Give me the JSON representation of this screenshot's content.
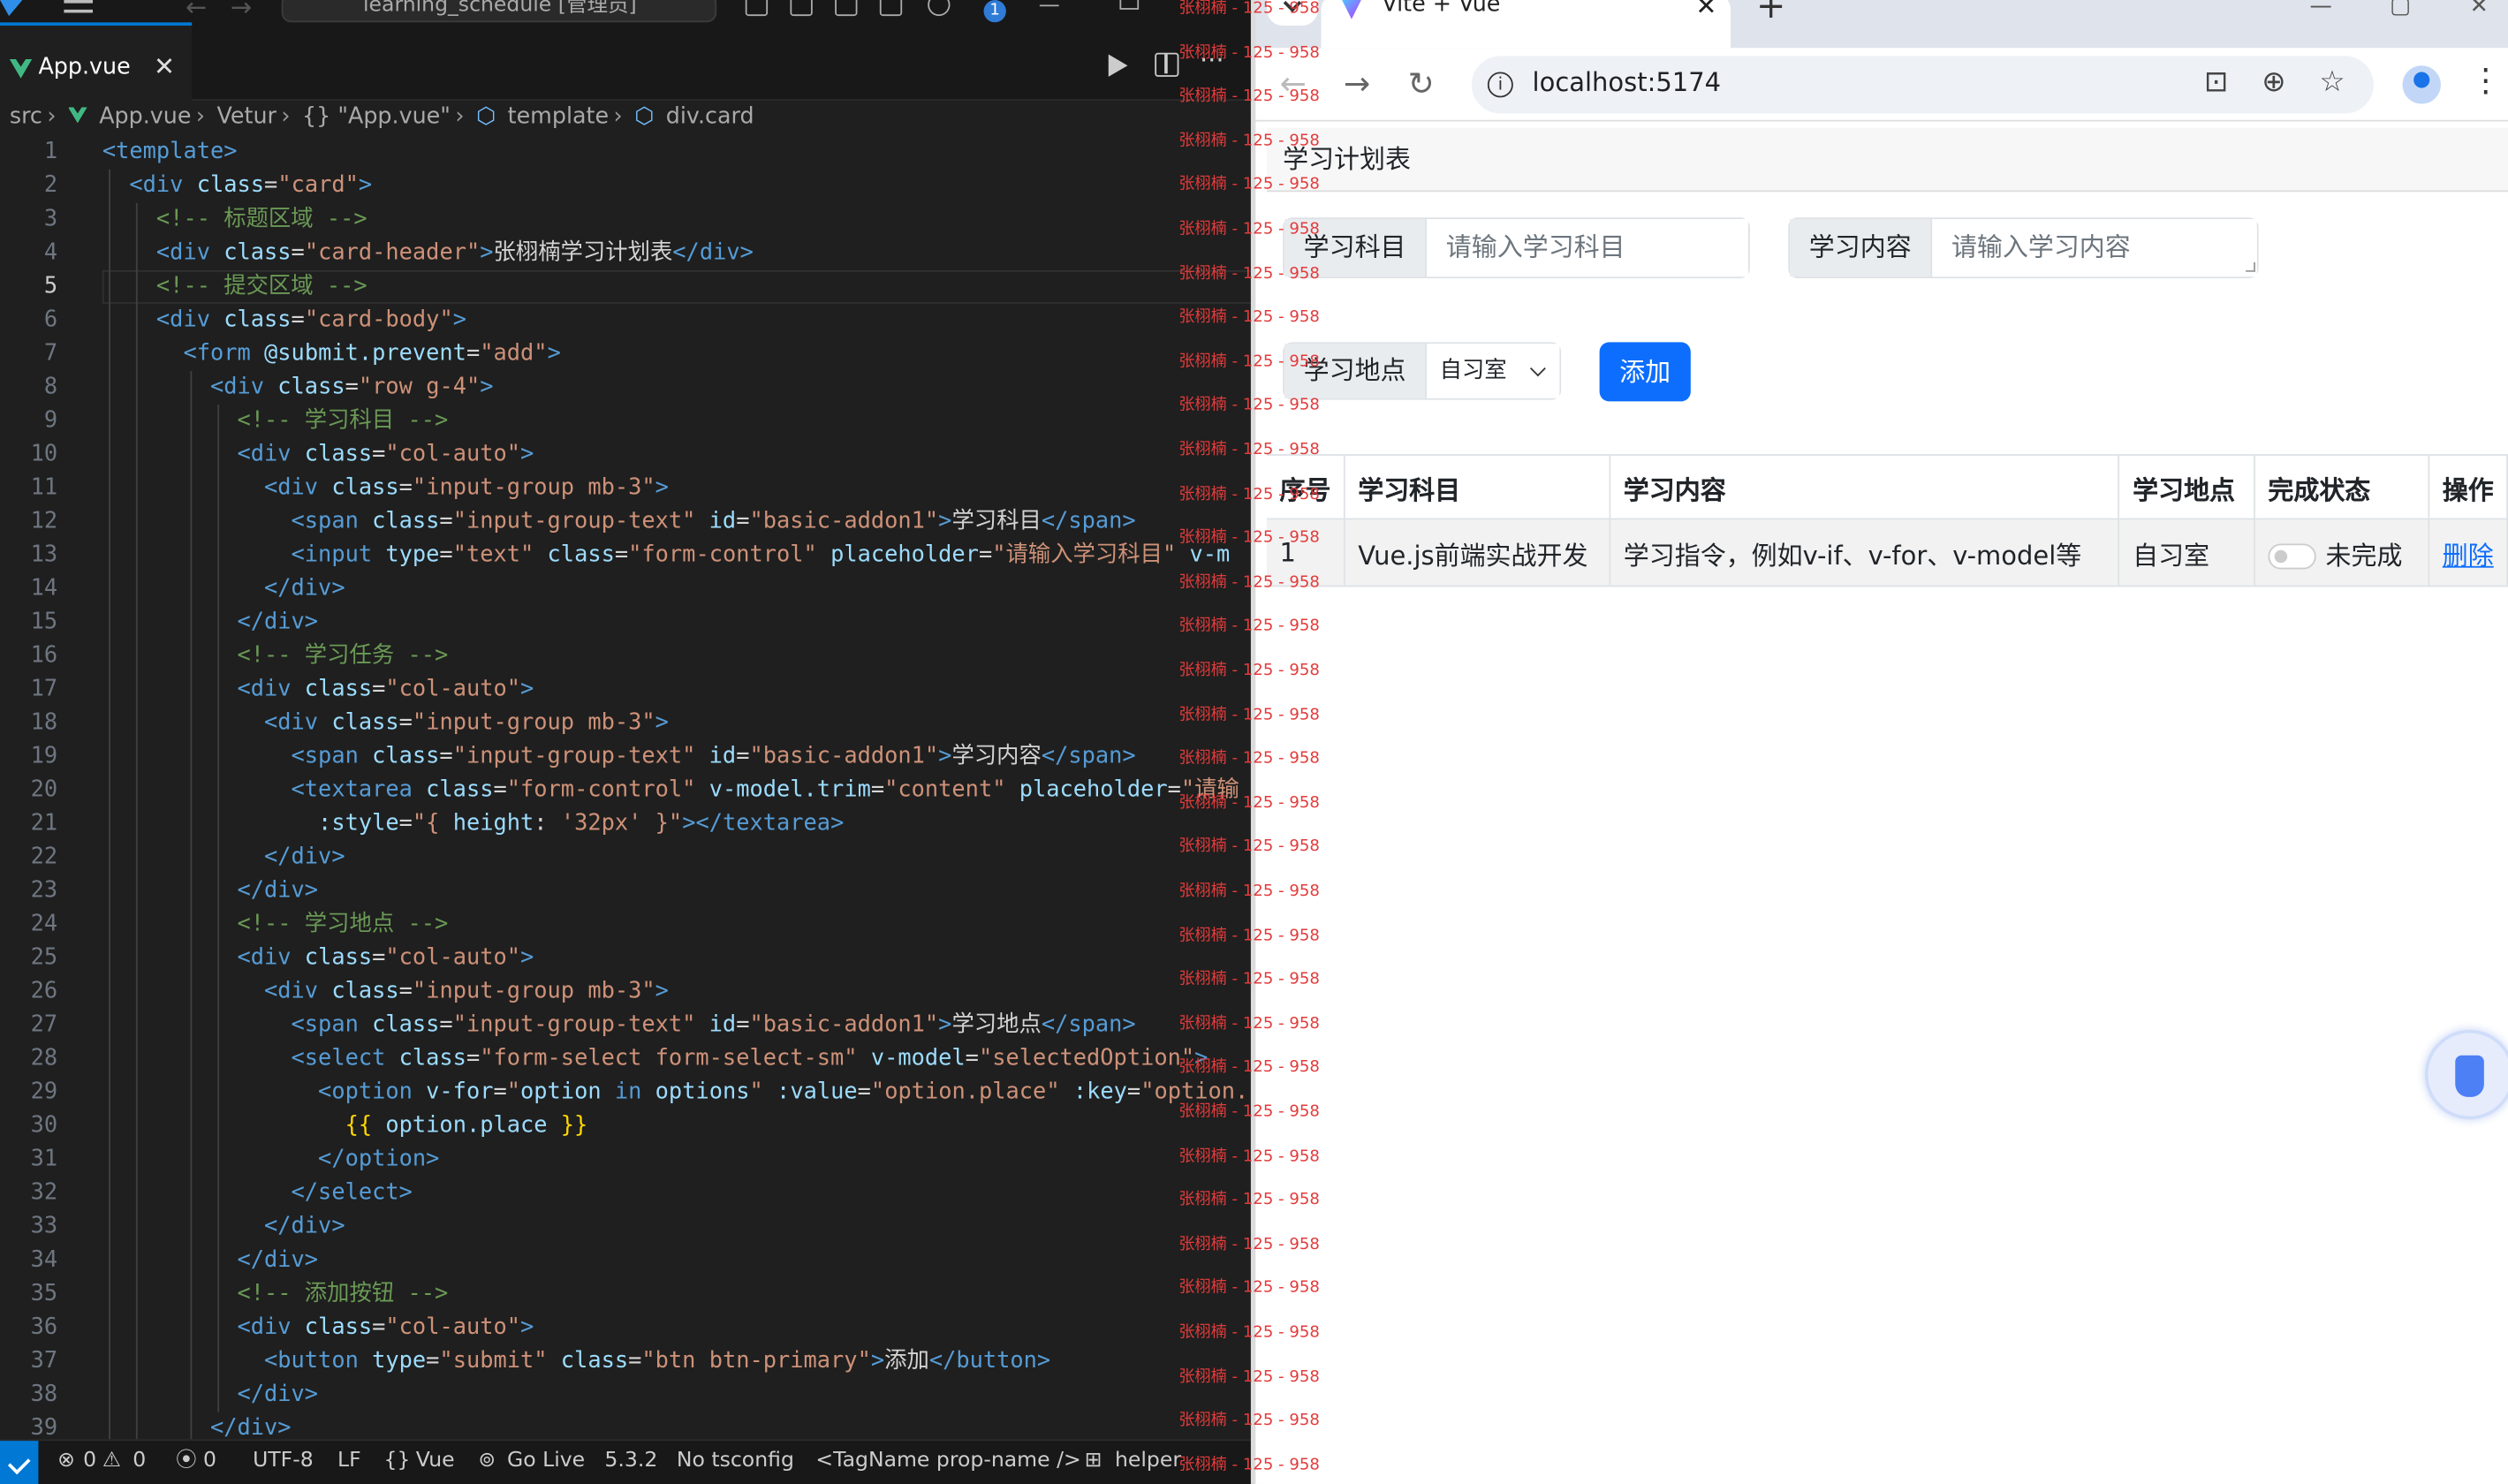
{
  "vscode": {
    "command_center": "learning_schedule [管理员]",
    "notifications": "1",
    "tab_label": "App.vue",
    "breadcrumb": [
      "src",
      "App.vue",
      "Vetur",
      "{} \"App.vue\"",
      "template",
      "div.card"
    ],
    "line_numbers": [
      "1",
      "2",
      "3",
      "4",
      "5",
      "6",
      "7",
      "8",
      "9",
      "10",
      "11",
      "12",
      "13",
      "14",
      "15",
      "16",
      "17",
      "18",
      "19",
      "20",
      "21",
      "22",
      "23",
      "24",
      "25",
      "26",
      "27",
      "28",
      "29",
      "30",
      "31",
      "32",
      "33",
      "34",
      "35",
      "36",
      "37",
      "38",
      "39"
    ],
    "current_line": "5",
    "status": {
      "errors": "0",
      "warnings": "0",
      "ports": "0",
      "encoding": "UTF-8",
      "eol": "LF",
      "language": "Vue",
      "go_live": "Go Live",
      "version": "5.3.2",
      "tsconfig": "No tsconfig",
      "tagname": "<TagName prop-name />",
      "helper": "helper"
    }
  },
  "code_lines": [
    [
      [
        "t",
        "<template>"
      ]
    ],
    [
      [
        "t",
        "  <div "
      ],
      [
        "a",
        "class"
      ],
      [
        "w",
        "="
      ],
      [
        "s",
        "\"card\""
      ],
      [
        "t",
        ">"
      ]
    ],
    [
      [
        "c",
        "    <!-- 标题区域 -->"
      ]
    ],
    [
      [
        "t",
        "    <div "
      ],
      [
        "a",
        "class"
      ],
      [
        "w",
        "="
      ],
      [
        "s",
        "\"card-header\""
      ],
      [
        "t",
        ">"
      ],
      [
        "w",
        "张栩楠学习计划表"
      ],
      [
        "t",
        "</div>"
      ]
    ],
    [
      [
        "c",
        "    <!-- 提交区域 -->"
      ]
    ],
    [
      [
        "t",
        "    <div "
      ],
      [
        "a",
        "class"
      ],
      [
        "w",
        "="
      ],
      [
        "s",
        "\"card-body\""
      ],
      [
        "t",
        ">"
      ]
    ],
    [
      [
        "t",
        "      <form "
      ],
      [
        "a",
        "@submit.prevent"
      ],
      [
        "w",
        "="
      ],
      [
        "s",
        "\"add\""
      ],
      [
        "t",
        ">"
      ]
    ],
    [
      [
        "t",
        "        <div "
      ],
      [
        "a",
        "class"
      ],
      [
        "w",
        "="
      ],
      [
        "s",
        "\"row g-4\""
      ],
      [
        "t",
        ">"
      ]
    ],
    [
      [
        "c",
        "          <!-- 学习科目 -->"
      ]
    ],
    [
      [
        "t",
        "          <div "
      ],
      [
        "a",
        "class"
      ],
      [
        "w",
        "="
      ],
      [
        "s",
        "\"col-auto\""
      ],
      [
        "t",
        ">"
      ]
    ],
    [
      [
        "t",
        "            <div "
      ],
      [
        "a",
        "class"
      ],
      [
        "w",
        "="
      ],
      [
        "s",
        "\"input-group mb-3\""
      ],
      [
        "t",
        ">"
      ]
    ],
    [
      [
        "t",
        "              <span "
      ],
      [
        "a",
        "class"
      ],
      [
        "w",
        "="
      ],
      [
        "s",
        "\"input-group-text\""
      ],
      [
        "a",
        " id"
      ],
      [
        "w",
        "="
      ],
      [
        "s",
        "\"basic-addon1\""
      ],
      [
        "t",
        ">"
      ],
      [
        "w",
        "学习科目"
      ],
      [
        "t",
        "</span>"
      ]
    ],
    [
      [
        "t",
        "              <input "
      ],
      [
        "a",
        "type"
      ],
      [
        "w",
        "="
      ],
      [
        "s",
        "\"text\""
      ],
      [
        "a",
        " class"
      ],
      [
        "w",
        "="
      ],
      [
        "s",
        "\"form-control\""
      ],
      [
        "a",
        " placeholder"
      ],
      [
        "w",
        "="
      ],
      [
        "s",
        "\"请输入学习科目\""
      ],
      [
        "a",
        " v-m"
      ]
    ],
    [
      [
        "t",
        "            </div>"
      ]
    ],
    [
      [
        "t",
        "          </div>"
      ]
    ],
    [
      [
        "c",
        "          <!-- 学习任务 -->"
      ]
    ],
    [
      [
        "t",
        "          <div "
      ],
      [
        "a",
        "class"
      ],
      [
        "w",
        "="
      ],
      [
        "s",
        "\"col-auto\""
      ],
      [
        "t",
        ">"
      ]
    ],
    [
      [
        "t",
        "            <div "
      ],
      [
        "a",
        "class"
      ],
      [
        "w",
        "="
      ],
      [
        "s",
        "\"input-group mb-3\""
      ],
      [
        "t",
        ">"
      ]
    ],
    [
      [
        "t",
        "              <span "
      ],
      [
        "a",
        "class"
      ],
      [
        "w",
        "="
      ],
      [
        "s",
        "\"input-group-text\""
      ],
      [
        "a",
        " id"
      ],
      [
        "w",
        "="
      ],
      [
        "s",
        "\"basic-addon1\""
      ],
      [
        "t",
        ">"
      ],
      [
        "w",
        "学习内容"
      ],
      [
        "t",
        "</span>"
      ]
    ],
    [
      [
        "t",
        "              <textarea "
      ],
      [
        "a",
        "class"
      ],
      [
        "w",
        "="
      ],
      [
        "s",
        "\"form-control\""
      ],
      [
        "a",
        " v-model.trim"
      ],
      [
        "w",
        "="
      ],
      [
        "s",
        "\"content\""
      ],
      [
        "a",
        " placeholder"
      ],
      [
        "w",
        "="
      ],
      [
        "s",
        "\"请输"
      ]
    ],
    [
      [
        "a",
        "                :style"
      ],
      [
        "w",
        "="
      ],
      [
        "s",
        "\"{ "
      ],
      [
        "a",
        "height"
      ],
      [
        "w",
        ": "
      ],
      [
        "s",
        "'32px'"
      ],
      [
        "s",
        " }\""
      ],
      [
        "t",
        "></textarea>"
      ]
    ],
    [
      [
        "t",
        "            </div>"
      ]
    ],
    [
      [
        "t",
        "          </div>"
      ]
    ],
    [
      [
        "c",
        "          <!-- 学习地点 -->"
      ]
    ],
    [
      [
        "t",
        "          <div "
      ],
      [
        "a",
        "class"
      ],
      [
        "w",
        "="
      ],
      [
        "s",
        "\"col-auto\""
      ],
      [
        "t",
        ">"
      ]
    ],
    [
      [
        "t",
        "            <div "
      ],
      [
        "a",
        "class"
      ],
      [
        "w",
        "="
      ],
      [
        "s",
        "\"input-group mb-3\""
      ],
      [
        "t",
        ">"
      ]
    ],
    [
      [
        "t",
        "              <span "
      ],
      [
        "a",
        "class"
      ],
      [
        "w",
        "="
      ],
      [
        "s",
        "\"input-group-text\""
      ],
      [
        "a",
        " id"
      ],
      [
        "w",
        "="
      ],
      [
        "s",
        "\"basic-addon1\""
      ],
      [
        "t",
        ">"
      ],
      [
        "w",
        "学习地点"
      ],
      [
        "t",
        "</span>"
      ]
    ],
    [
      [
        "t",
        "              <select "
      ],
      [
        "a",
        "class"
      ],
      [
        "w",
        "="
      ],
      [
        "s",
        "\"form-select form-select-sm\""
      ],
      [
        "a",
        " v-model"
      ],
      [
        "w",
        "="
      ],
      [
        "s",
        "\"selectedOption\""
      ],
      [
        "t",
        ">"
      ]
    ],
    [
      [
        "t",
        "                <option "
      ],
      [
        "a",
        "v-for"
      ],
      [
        "w",
        "="
      ],
      [
        "s",
        "\""
      ],
      [
        "a",
        "option"
      ],
      [
        "t",
        " in "
      ],
      [
        "a",
        "options"
      ],
      [
        "s",
        "\""
      ],
      [
        "a",
        " :value"
      ],
      [
        "w",
        "="
      ],
      [
        "s",
        "\"option.place\""
      ],
      [
        "a",
        " :key"
      ],
      [
        "w",
        "="
      ],
      [
        "s",
        "\"option."
      ]
    ],
    [
      [
        "b",
        "                  {{ "
      ],
      [
        "a",
        "option.place"
      ],
      [
        "b",
        " }}"
      ]
    ],
    [
      [
        "t",
        "                </option>"
      ]
    ],
    [
      [
        "t",
        "              </select>"
      ]
    ],
    [
      [
        "t",
        "            </div>"
      ]
    ],
    [
      [
        "t",
        "          </div>"
      ]
    ],
    [
      [
        "c",
        "          <!-- 添加按钮 -->"
      ]
    ],
    [
      [
        "t",
        "          <div "
      ],
      [
        "a",
        "class"
      ],
      [
        "w",
        "="
      ],
      [
        "s",
        "\"col-auto\""
      ],
      [
        "t",
        ">"
      ]
    ],
    [
      [
        "t",
        "            <button "
      ],
      [
        "a",
        "type"
      ],
      [
        "w",
        "="
      ],
      [
        "s",
        "\"submit\""
      ],
      [
        "a",
        " class"
      ],
      [
        "w",
        "="
      ],
      [
        "s",
        "\"btn btn-primary\""
      ],
      [
        "t",
        ">"
      ],
      [
        "w",
        "添加"
      ],
      [
        "t",
        "</button>"
      ]
    ],
    [
      [
        "t",
        "          </div>"
      ]
    ],
    [
      [
        "t",
        "        </div>"
      ]
    ]
  ],
  "browser": {
    "tab_title": "Vite + Vue",
    "url": "localhost:5174"
  },
  "app": {
    "header": "学习计划表",
    "subject_label": "学习科目",
    "subject_placeholder": "请输入学习科目",
    "content_label": "学习内容",
    "content_placeholder": "请输入学习内容",
    "place_label": "学习地点",
    "place_selected": "自习室",
    "add_button": "添加",
    "table": {
      "headers": [
        "序号",
        "学习科目",
        "学习内容",
        "学习地点",
        "完成状态",
        "操作"
      ],
      "rows": [
        {
          "index": "1",
          "subject": "Vue.js前端实战开发",
          "content": "学习指令，例如v-if、v-for、v-model等",
          "place": "自习室",
          "status": "未完成",
          "action": "删除"
        }
      ]
    }
  },
  "watermark": "张栩楠 - 125 - 958",
  "colors": {
    "accent": "#0d6efd",
    "vscode_bg": "#1f1f1f",
    "watermark": "#e23b3b"
  }
}
